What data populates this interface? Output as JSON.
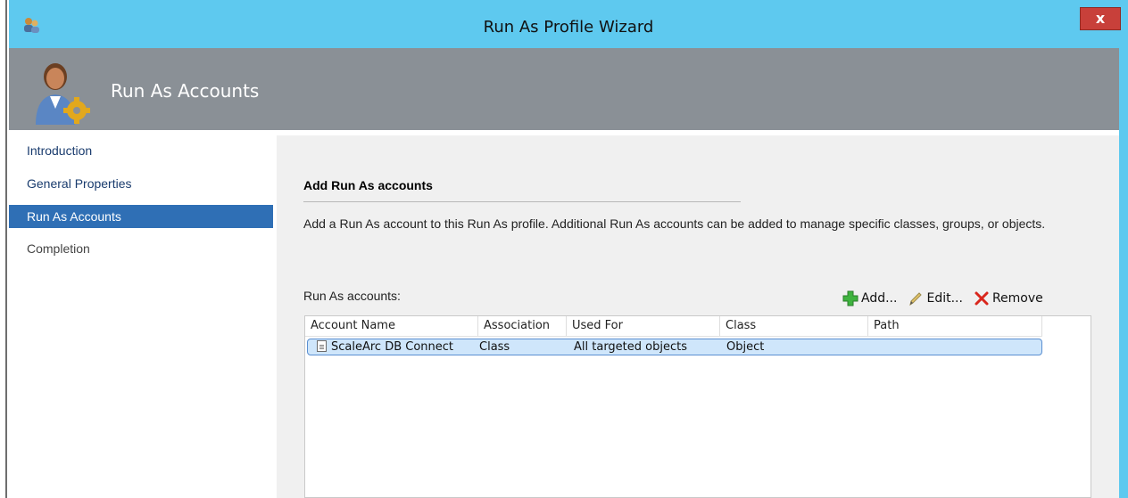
{
  "window": {
    "title": "Run As Profile Wizard",
    "close_label": "x"
  },
  "header": {
    "title": "Run As Accounts"
  },
  "nav": {
    "items": [
      {
        "label": "Introduction",
        "state": "done"
      },
      {
        "label": "General Properties",
        "state": "done"
      },
      {
        "label": "Run As Accounts",
        "state": "active"
      },
      {
        "label": "Completion",
        "state": "pending"
      }
    ]
  },
  "content": {
    "section_title": "Add Run As accounts",
    "description": "Add a Run As account to this Run As profile.  Additional Run As accounts can be added to manage specific classes, groups, or objects.",
    "list_label": "Run As accounts:",
    "toolbar": {
      "add_label": "Add...",
      "edit_label": "Edit...",
      "remove_label": "Remove"
    },
    "table": {
      "columns": [
        "Account Name",
        "Association",
        "Used For",
        "Class",
        "Path"
      ],
      "rows": [
        {
          "account_name": "ScaleArc DB Connect",
          "association": "Class",
          "used_for": "All targeted objects",
          "class": "Object",
          "path": ""
        }
      ]
    }
  },
  "colors": {
    "titlebar": "#5ec9ef",
    "header": "#8a9096",
    "nav_active": "#2f6fb5",
    "close": "#c8403a"
  },
  "icons": {
    "app": "users-icon",
    "header": "user-gear-icon",
    "add": "plus-icon",
    "edit": "pencil-icon",
    "remove": "x-icon",
    "row": "document-icon"
  }
}
